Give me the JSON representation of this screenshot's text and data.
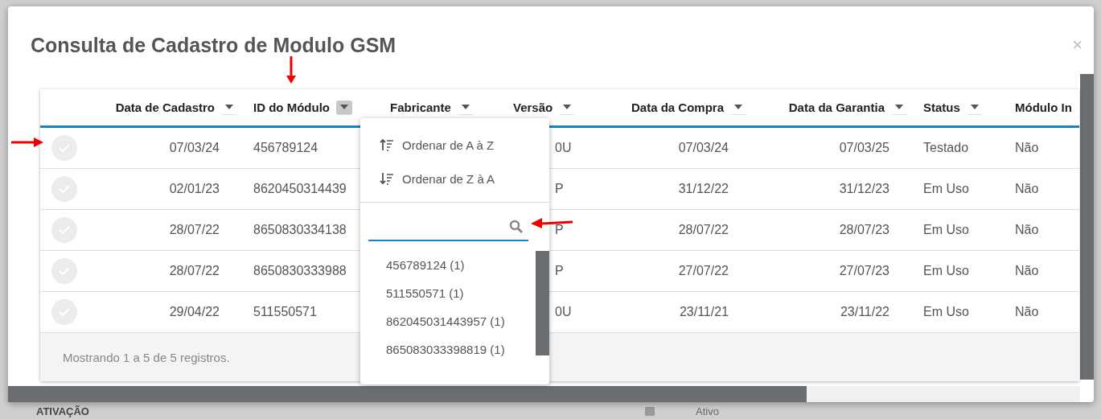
{
  "background": {
    "section_title": "ATIVAÇÃO",
    "status": "Ativo"
  },
  "dialog": {
    "title": "Consulta de Cadastro de Modulo GSM",
    "close": "×"
  },
  "table": {
    "columns": [
      {
        "label": "Data de Cadastro",
        "filter_open": false
      },
      {
        "label": "ID do Módulo",
        "filter_open": true
      },
      {
        "label": "Fabricante",
        "filter_open": false
      },
      {
        "label": "Versão",
        "filter_open": false
      },
      {
        "label": "Data da Compra",
        "filter_open": false
      },
      {
        "label": "Data da Garantia",
        "filter_open": false
      },
      {
        "label": "Status",
        "filter_open": false
      },
      {
        "label": "Módulo In"
      }
    ],
    "rows": [
      {
        "checked": false,
        "registered": "07/03/24",
        "module_id": "456789124",
        "version": "0U",
        "purchase": "07/03/24",
        "warranty": "07/03/25",
        "status": "Testado",
        "module_in": "Não"
      },
      {
        "checked": false,
        "registered": "02/01/23",
        "module_id": "8620450314439",
        "version": "P",
        "purchase": "31/12/22",
        "warranty": "31/12/23",
        "status": "Em Uso",
        "module_in": "Não"
      },
      {
        "checked": false,
        "registered": "28/07/22",
        "module_id": "8650830334138",
        "version": "P",
        "purchase": "28/07/22",
        "warranty": "28/07/23",
        "status": "Em Uso",
        "module_in": "Não"
      },
      {
        "checked": false,
        "registered": "28/07/22",
        "module_id": "8650830333988",
        "version": "P",
        "purchase": "27/07/22",
        "warranty": "27/07/23",
        "status": "Em Uso",
        "module_in": "Não"
      },
      {
        "checked": false,
        "registered": "29/04/22",
        "module_id": "511550571",
        "version": "0U",
        "purchase": "23/11/21",
        "warranty": "23/11/22",
        "status": "Em Uso",
        "module_in": "Não"
      }
    ],
    "footer": "Mostrando 1 a 5 de 5 registros."
  },
  "filter_menu": {
    "sort_options": [
      {
        "kind": "ascending",
        "label": "Ordenar de A à Z"
      },
      {
        "kind": "descending",
        "label": "Ordenar de Z à A"
      }
    ],
    "values": [
      "456789124 (1)",
      "511550571 (1)",
      "862045031443957 (1)",
      "865083033398819 (1)"
    ]
  }
}
